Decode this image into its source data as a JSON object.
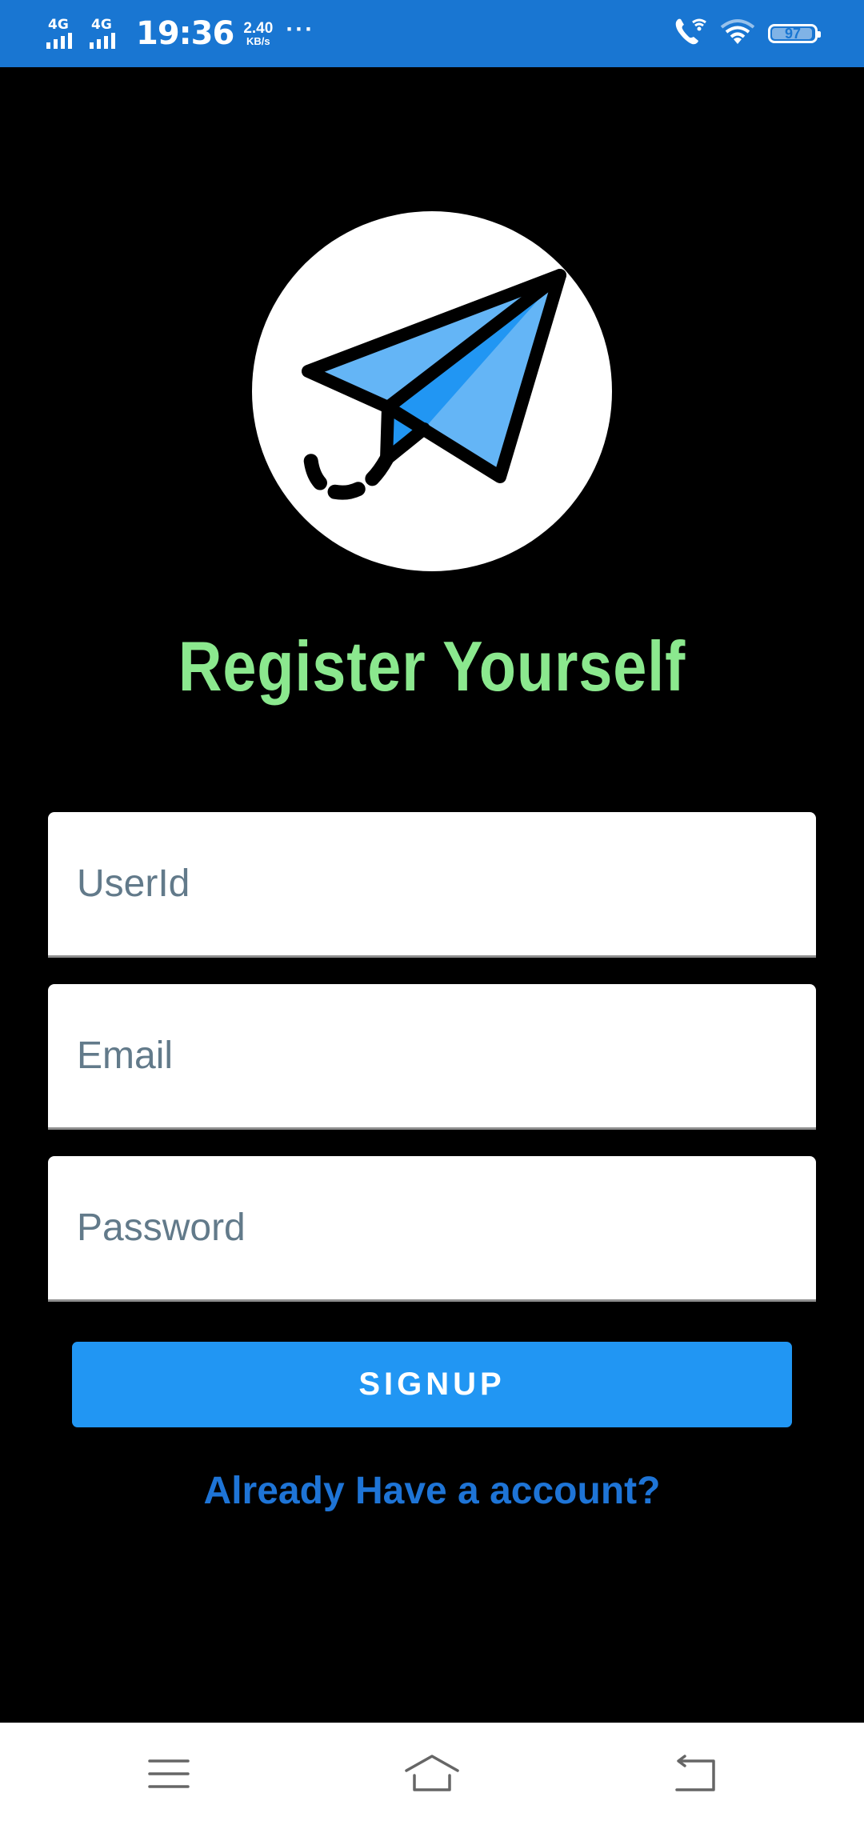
{
  "status_bar": {
    "network_1": "4G",
    "network_2": "4G",
    "time": "19:36",
    "speed_value": "2.40",
    "speed_unit": "KB/s",
    "more": "···",
    "battery": "97"
  },
  "icons": {
    "logo": "paper-plane-icon",
    "call": "wifi-call-icon",
    "wifi": "wifi-icon",
    "nav_menu": "menu-icon",
    "nav_home": "home-icon",
    "nav_back": "back-icon"
  },
  "page": {
    "title": "Register Yourself",
    "userid_placeholder": "UserId",
    "email_placeholder": "Email",
    "password_placeholder": "Password",
    "signup_label": "SIGNUP",
    "login_link": "Already Have a account?"
  },
  "colors": {
    "status_bar": "#1976d2",
    "background": "#000000",
    "title": "#8be88e",
    "button": "#2196f3",
    "link": "#1e74d6",
    "plane": "#64b5f6"
  }
}
